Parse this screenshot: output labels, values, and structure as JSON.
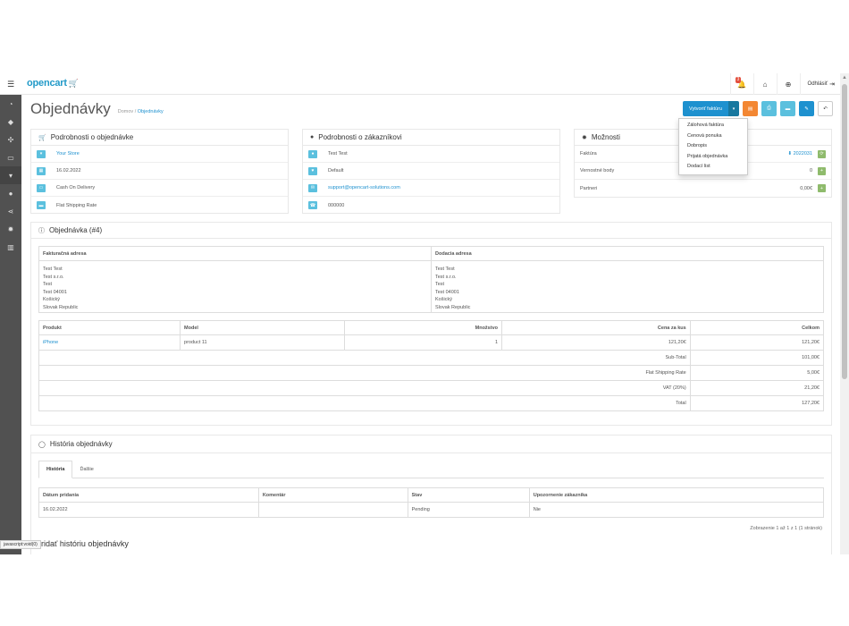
{
  "header": {
    "logo": "opencart",
    "notification_count": "3",
    "logout_label": "Odhlásiť"
  },
  "page": {
    "title": "Objednávky",
    "breadcrumb": [
      "Domov",
      "Objednávky"
    ],
    "breadcrumb_sep": "/"
  },
  "actions": {
    "create_invoice": "Vytvoriť faktúru",
    "dropdown": [
      "Zálohová faktúra",
      "Cenová ponuka",
      "Dobropis",
      "Prijatá objednávka",
      "Dodací list"
    ]
  },
  "order_details": {
    "title": "Podrobnosti o objednávke",
    "store": "Your Store",
    "date": "16.02.2022",
    "payment": "Cash On Delivery",
    "shipping": "Flat Shipping Rate"
  },
  "customer_details": {
    "title": "Podrobnosti o zákazníkovi",
    "name": "Test Test",
    "group": "Default",
    "email": "support@opencart-solutions.com",
    "phone": "000000"
  },
  "options": {
    "title": "Možnosti",
    "rows": [
      {
        "label": "Faktúra",
        "value": "2022031"
      },
      {
        "label": "Vernostné body",
        "value": "0"
      },
      {
        "label": "Partneri",
        "value": "0,00€"
      }
    ]
  },
  "order": {
    "title": "Objednávka (#4)",
    "billing_header": "Fakturačná adresa",
    "shipping_header": "Dodacia adresa",
    "billing_lines": [
      "Test Test",
      "Test s.r.o.",
      "Test",
      "Test 04001",
      "Košický",
      "Slovak Republic"
    ],
    "shipping_lines": [
      "Test Test",
      "Test s.r.o.",
      "Test",
      "Test 04001",
      "Košický",
      "Slovak Republic"
    ],
    "product_headers": [
      "Produkt",
      "Model",
      "Množstvo",
      "Cena za kus",
      "Celkom"
    ],
    "product": {
      "name": "iPhone",
      "model": "product 11",
      "qty": "1",
      "price": "121,20€",
      "total": "121,20€"
    },
    "totals": [
      {
        "label": "Sub-Total",
        "value": "101,00€"
      },
      {
        "label": "Flat Shipping Rate",
        "value": "5,00€"
      },
      {
        "label": "VAT (20%)",
        "value": "21,20€"
      },
      {
        "label": "Total",
        "value": "127,20€"
      }
    ]
  },
  "history": {
    "title": "História objednávky",
    "tabs": [
      "História",
      "Ďalšie"
    ],
    "headers": [
      "Dátum pridania",
      "Komentár",
      "Stav",
      "Upozornenie zákazníka"
    ],
    "row": {
      "date": "16.02.2022",
      "comment": "",
      "status": "Pending",
      "notify": "Nie"
    },
    "pagination": "Zobrazenie 1 až 1 z 1 (1 stránok)",
    "add_title": "Pridať históriu objednávky"
  },
  "statusbar": "javascript:void(0)"
}
